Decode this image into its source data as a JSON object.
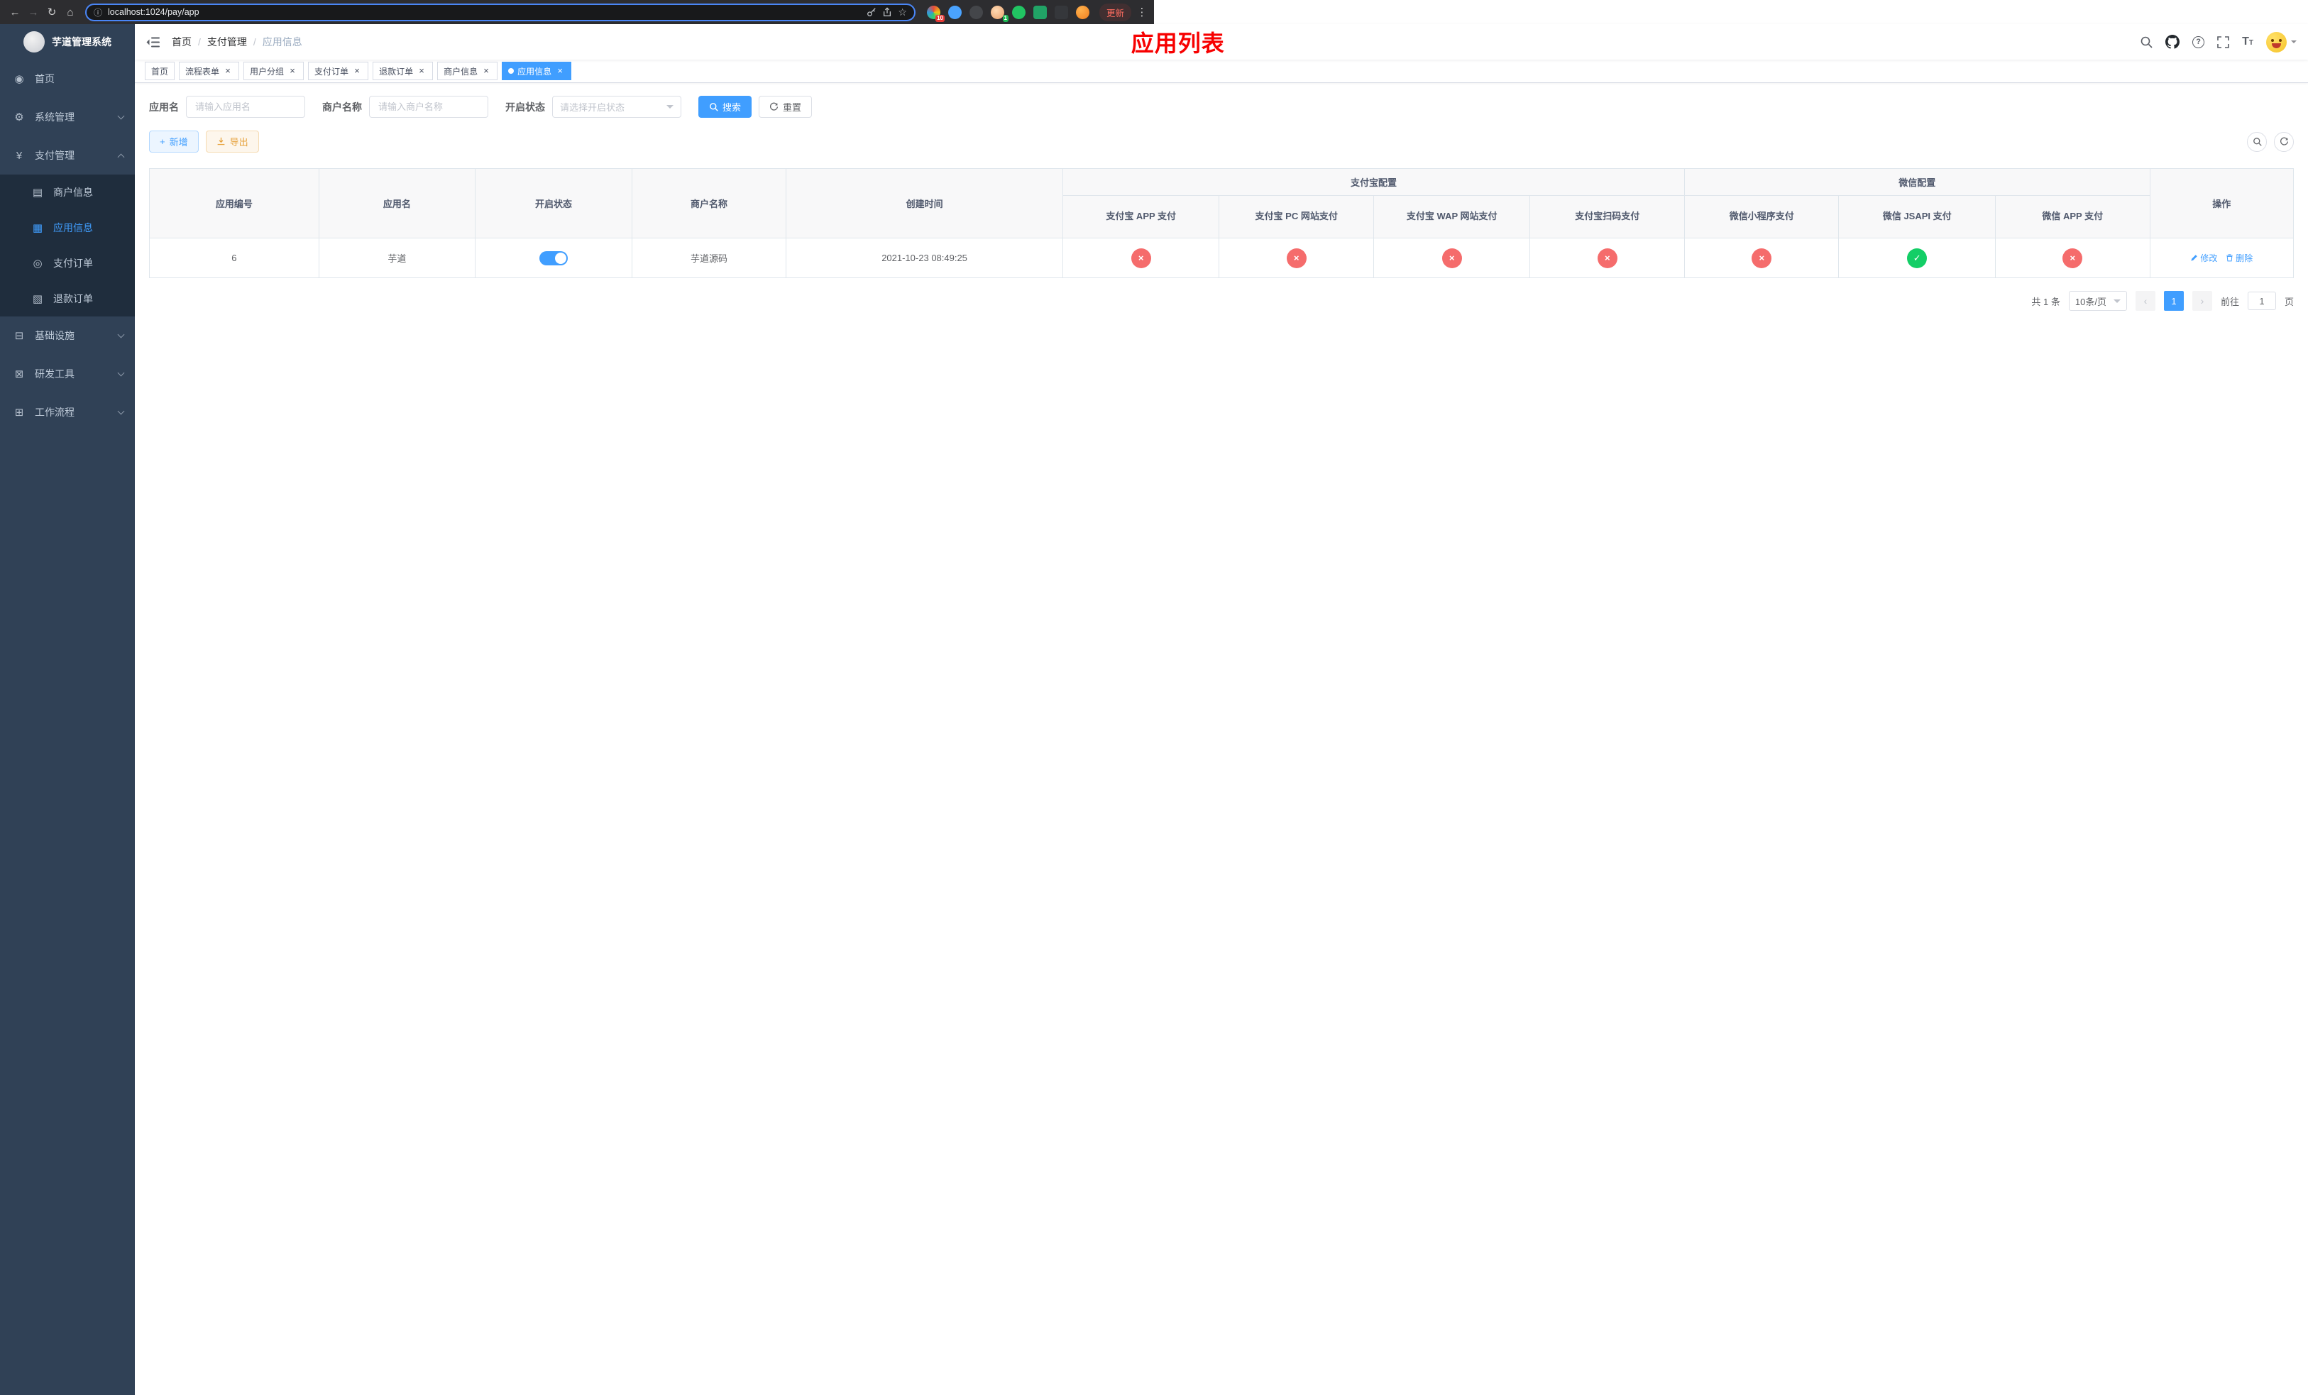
{
  "browser": {
    "url": "localhost:1024/pay/app",
    "update_label": "更新",
    "extension_badge_red": "10",
    "extension_badge_green": "1"
  },
  "app": {
    "title": "芋道管理系统"
  },
  "sidebar": {
    "items": [
      {
        "label": "首页",
        "icon": "dashboard-icon"
      },
      {
        "label": "系统管理",
        "icon": "gear-icon"
      },
      {
        "label": "支付管理",
        "icon": "yen-icon"
      },
      {
        "label": "基础设施",
        "icon": "infrastructure-icon"
      },
      {
        "label": "研发工具",
        "icon": "dev-tools-icon"
      },
      {
        "label": "工作流程",
        "icon": "workflow-icon"
      }
    ],
    "payment_submenu": [
      {
        "label": "商户信息",
        "icon": "merchant-card-icon"
      },
      {
        "label": "应用信息",
        "icon": "app-grid-icon"
      },
      {
        "label": "支付订单",
        "icon": "pay-order-icon"
      },
      {
        "label": "退款订单",
        "icon": "refund-order-icon"
      }
    ]
  },
  "header": {
    "breadcrumb": [
      "首页",
      "支付管理",
      "应用信息"
    ],
    "page_title": "应用列表"
  },
  "tabs": [
    {
      "label": "首页"
    },
    {
      "label": "流程表单"
    },
    {
      "label": "用户分组"
    },
    {
      "label": "支付订单"
    },
    {
      "label": "退款订单"
    },
    {
      "label": "商户信息"
    },
    {
      "label": "应用信息"
    }
  ],
  "filters": {
    "app_name_label": "应用名",
    "app_name_placeholder": "请输入应用名",
    "merchant_name_label": "商户名称",
    "merchant_name_placeholder": "请输入商户名称",
    "status_label": "开启状态",
    "status_placeholder": "请选择开启状态",
    "search_button": "搜索",
    "reset_button": "重置"
  },
  "toolbar": {
    "add_button": "新增",
    "export_button": "导出"
  },
  "table": {
    "columns": {
      "app_id": "应用编号",
      "app_name": "应用名",
      "status": "开启状态",
      "merchant_name": "商户名称",
      "create_time": "创建时间",
      "alipay_group": "支付宝配置",
      "wechat_group": "微信配置",
      "actions": "操作"
    },
    "sub_columns": [
      "支付宝 APP 支付",
      "支付宝 PC 网站支付",
      "支付宝 WAP 网站支付",
      "支付宝扫码支付",
      "微信小程序支付",
      "微信 JSAPI 支付",
      "微信 APP 支付"
    ],
    "rows": [
      {
        "app_id": "6",
        "app_name": "芋道",
        "enabled": true,
        "merchant_name": "芋道源码",
        "create_time": "2021-10-23 08:49:25",
        "configs": [
          "no",
          "no",
          "no",
          "no",
          "no",
          "yes",
          "no"
        ],
        "edit_label": "修改",
        "delete_label": "删除"
      }
    ]
  },
  "pagination": {
    "total_text": "共 1 条",
    "page_size": "10条/页",
    "current_page": "1",
    "goto_prefix": "前往",
    "goto_value": "1",
    "goto_suffix": "页"
  },
  "colors": {
    "primary": "#409eff",
    "danger": "#f56c6c",
    "success": "#13ce66",
    "sidebar_bg": "#304156",
    "submenu_bg": "#1f2d3d",
    "title_red": "#f70000"
  }
}
